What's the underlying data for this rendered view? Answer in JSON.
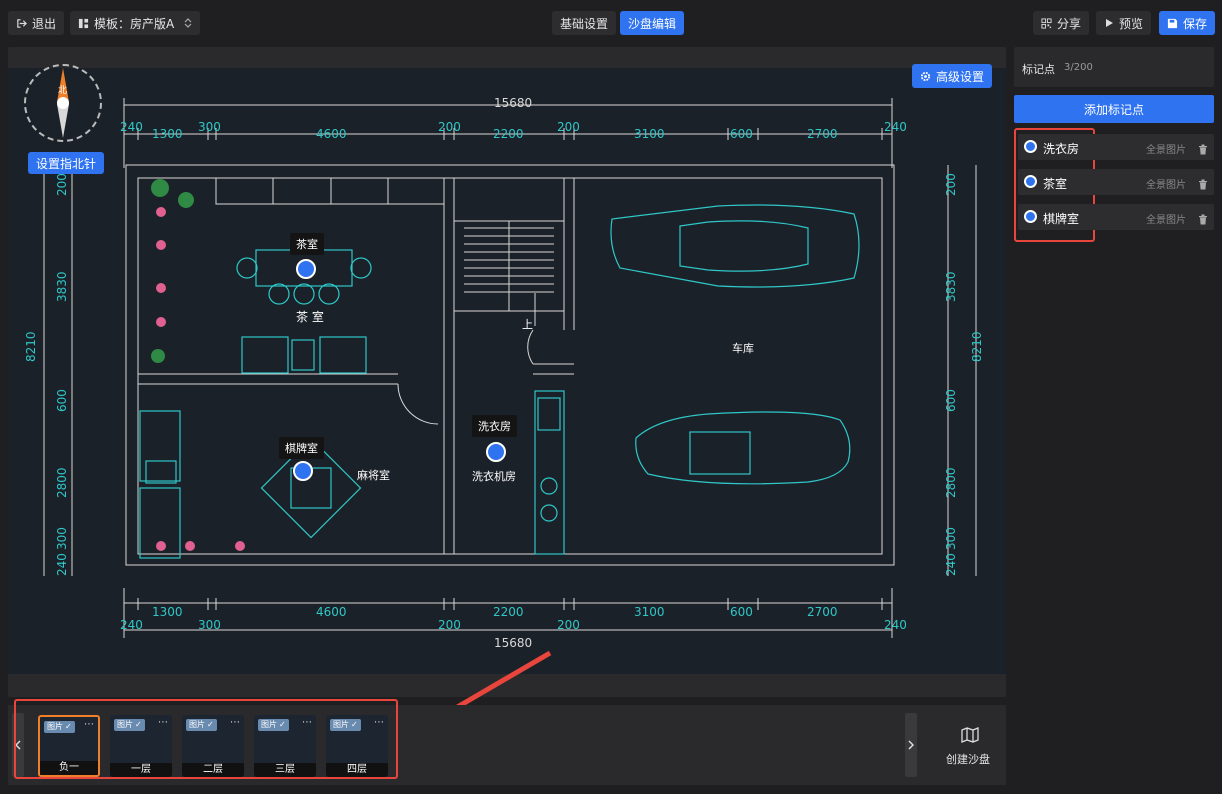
{
  "topbar": {
    "exit_label": "退出",
    "template_label": "模板：房产版A",
    "tab_basic": "基础设置",
    "tab_sandbox": "沙盘编辑",
    "share_label": "分享",
    "preview_label": "预览",
    "save_label": "保存"
  },
  "canvas": {
    "advanced_label": "高级设置",
    "compass_north": "北",
    "set_compass_label": "设置指北针"
  },
  "plan": {
    "total_width": "15680",
    "total_depth": "8210",
    "top_dims": [
      "240",
      "1300",
      "300",
      "4600",
      "200",
      "2200",
      "200",
      "3100",
      "600",
      "2700",
      "240"
    ],
    "left_dims": [
      "200",
      "3830",
      "600",
      "2800",
      "300",
      "240"
    ],
    "room_tea": "茶 室",
    "room_mahjong": "麻将室",
    "room_laundry": "洗衣机房",
    "room_garage": "车库",
    "stairs_up": "上"
  },
  "markers": [
    {
      "label": "茶室"
    },
    {
      "label": "棋牌室"
    },
    {
      "label": "洗衣房"
    }
  ],
  "panel": {
    "title": "标记点",
    "count": "3/200",
    "add_label": "添加标记点",
    "items": [
      {
        "name": "洗衣房",
        "action": "全景图片"
      },
      {
        "name": "茶室",
        "action": "全景图片"
      },
      {
        "name": "棋牌室",
        "action": "全景图片"
      }
    ]
  },
  "floors": {
    "tag_label": "图片",
    "items": [
      {
        "name": "负一"
      },
      {
        "name": "一层"
      },
      {
        "name": "二层"
      },
      {
        "name": "三层"
      },
      {
        "name": "四层"
      }
    ],
    "create_label": "创建沙盘"
  },
  "colors": {
    "accent": "#2f73f0",
    "highlight": "#e8463c",
    "cad_line": "#d8d8d8",
    "cad_cyan": "#2fc7c7"
  }
}
